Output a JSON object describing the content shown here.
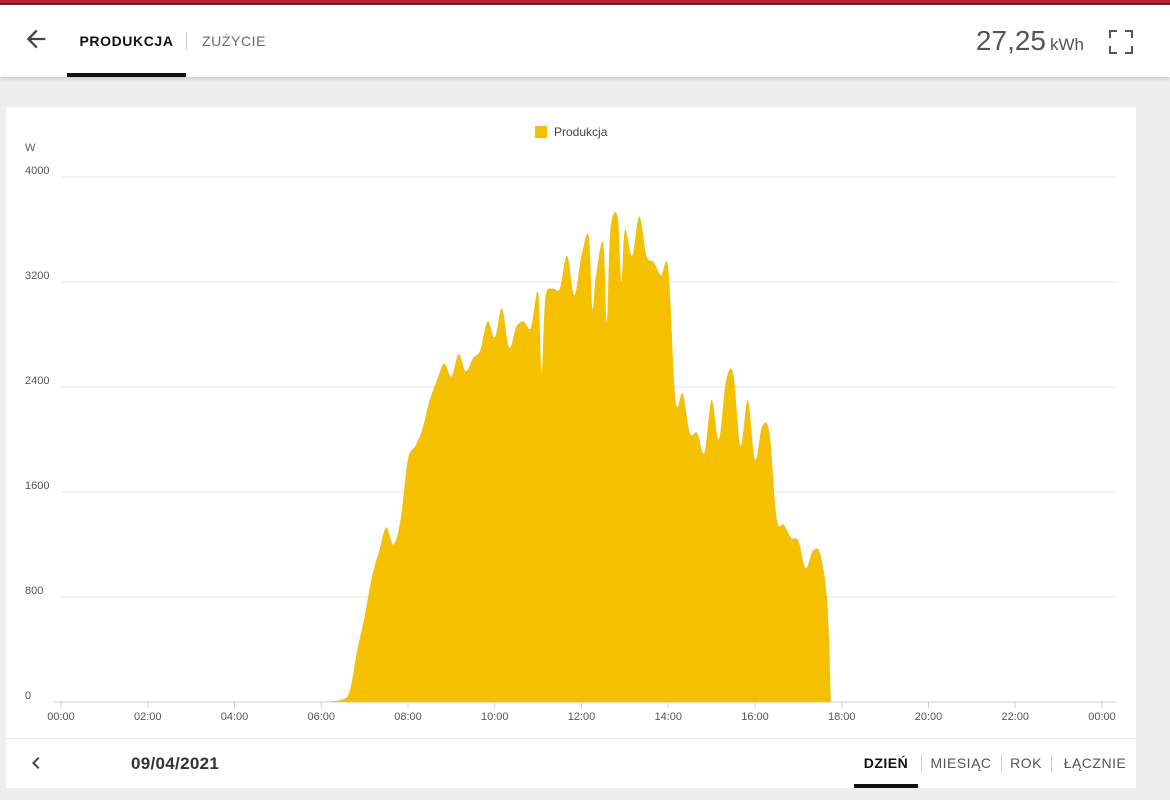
{
  "header": {
    "tabs": [
      {
        "label": "PRODUKCJA",
        "active": true
      },
      {
        "label": "ZUŻYCIE",
        "active": false
      }
    ],
    "total_value": "27,25",
    "total_unit": "kWh"
  },
  "footer": {
    "date": "09/04/2021",
    "periods": [
      {
        "label": "DZIEŃ",
        "active": true
      },
      {
        "label": "MIESIĄC",
        "active": false
      },
      {
        "label": "ROK",
        "active": false
      },
      {
        "label": "ŁĄCZNIE",
        "active": false
      }
    ]
  },
  "colors": {
    "series": "#f5c000",
    "accent_bar": "#b9202f",
    "grid": "#e6e6e6",
    "text_axis": "#555555"
  },
  "icons": [
    "arrow-left-icon",
    "fullscreen-icon",
    "chevron-left-icon"
  ],
  "chart_data": {
    "type": "area",
    "title": "",
    "ylabel": "W",
    "xlabel": "",
    "legend": {
      "position": "top-center",
      "entries": [
        "Produkcja"
      ]
    },
    "grid": true,
    "ylim": [
      0,
      4000
    ],
    "yticks": [
      "0",
      "800",
      "1600",
      "2400",
      "3200",
      "4000"
    ],
    "xticks": [
      "00:00",
      "02:00",
      "04:00",
      "06:00",
      "08:00",
      "10:00",
      "12:00",
      "14:00",
      "16:00",
      "18:00",
      "20:00",
      "22:00",
      "00:00"
    ],
    "series": [
      {
        "name": "Produkcja",
        "points": [
          [
            "06:00",
            0
          ],
          [
            "06:30",
            20
          ],
          [
            "06:40",
            100
          ],
          [
            "06:50",
            400
          ],
          [
            "07:00",
            650
          ],
          [
            "07:10",
            950
          ],
          [
            "07:20",
            1150
          ],
          [
            "07:30",
            1330
          ],
          [
            "07:40",
            1200
          ],
          [
            "07:50",
            1400
          ],
          [
            "08:00",
            1850
          ],
          [
            "08:10",
            1950
          ],
          [
            "08:20",
            2080
          ],
          [
            "08:30",
            2300
          ],
          [
            "08:40",
            2450
          ],
          [
            "08:50",
            2580
          ],
          [
            "09:00",
            2480
          ],
          [
            "09:10",
            2650
          ],
          [
            "09:20",
            2520
          ],
          [
            "09:30",
            2620
          ],
          [
            "09:40",
            2680
          ],
          [
            "09:50",
            2900
          ],
          [
            "10:00",
            2780
          ],
          [
            "10:10",
            3000
          ],
          [
            "10:20",
            2700
          ],
          [
            "10:30",
            2860
          ],
          [
            "10:40",
            2900
          ],
          [
            "10:50",
            2850
          ],
          [
            "11:00",
            3120
          ],
          [
            "11:05",
            2500
          ],
          [
            "11:10",
            3080
          ],
          [
            "11:20",
            3150
          ],
          [
            "11:30",
            3150
          ],
          [
            "11:40",
            3400
          ],
          [
            "11:50",
            3100
          ],
          [
            "12:00",
            3400
          ],
          [
            "12:10",
            3550
          ],
          [
            "12:15",
            3000
          ],
          [
            "12:20",
            3250
          ],
          [
            "12:30",
            3500
          ],
          [
            "12:35",
            2900
          ],
          [
            "12:40",
            3600
          ],
          [
            "12:50",
            3700
          ],
          [
            "12:55",
            3200
          ],
          [
            "13:00",
            3600
          ],
          [
            "13:10",
            3400
          ],
          [
            "13:20",
            3700
          ],
          [
            "13:30",
            3400
          ],
          [
            "13:40",
            3350
          ],
          [
            "13:50",
            3250
          ],
          [
            "14:00",
            3300
          ],
          [
            "14:10",
            2300
          ],
          [
            "14:20",
            2350
          ],
          [
            "14:30",
            2050
          ],
          [
            "14:40",
            2050
          ],
          [
            "14:50",
            1900
          ],
          [
            "15:00",
            2300
          ],
          [
            "15:10",
            2000
          ],
          [
            "15:20",
            2450
          ],
          [
            "15:30",
            2500
          ],
          [
            "15:40",
            1950
          ],
          [
            "15:50",
            2300
          ],
          [
            "16:00",
            1850
          ],
          [
            "16:10",
            2100
          ],
          [
            "16:20",
            2050
          ],
          [
            "16:30",
            1400
          ],
          [
            "16:40",
            1350
          ],
          [
            "16:50",
            1250
          ],
          [
            "17:00",
            1230
          ],
          [
            "17:10",
            1020
          ],
          [
            "17:20",
            1150
          ],
          [
            "17:30",
            1130
          ],
          [
            "17:40",
            760
          ],
          [
            "17:45",
            0
          ]
        ]
      }
    ]
  }
}
